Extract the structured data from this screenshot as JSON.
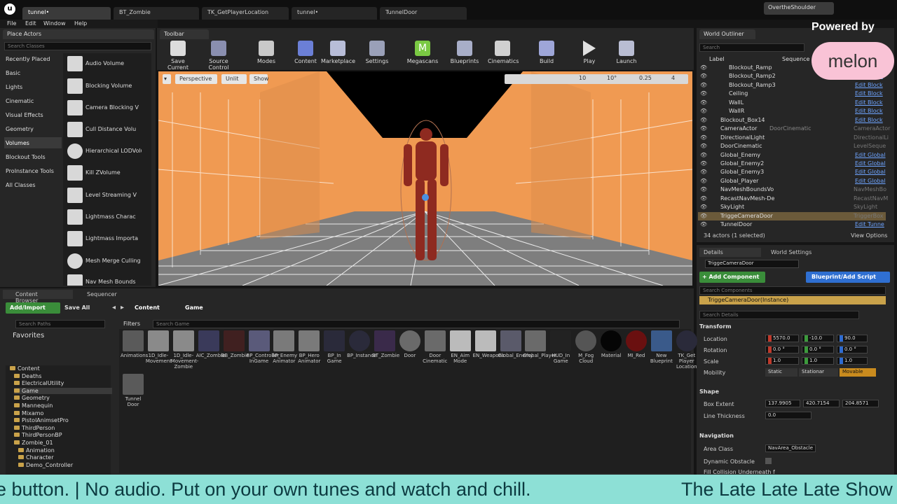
{
  "doc_tabs": [
    "tunnel•",
    "BT_Zombie",
    "TK_GetPlayerLocation",
    "tunnel•",
    "TunnelDoor"
  ],
  "user_tab": "OvertheShoulder",
  "menu": [
    "File",
    "Edit",
    "Window",
    "Help"
  ],
  "place_actors": {
    "tab": "Place Actors",
    "search_placeholder": "Search Classes",
    "categories": [
      "Recently Placed",
      "Basic",
      "Lights",
      "Cinematic",
      "Visual Effects",
      "Geometry",
      "Volumes",
      "Blockout Tools",
      "ProInstance Tools",
      "All Classes"
    ],
    "volumes": [
      "Audio Volume",
      "Blocking Volume",
      "Camera Blocking V",
      "Cull Distance Volu",
      "Hierarchical LODVolu",
      "Kill ZVolume",
      "Level Streaming V",
      "Lightmass Charac",
      "Lightmass Importa",
      "Mesh Merge Culling V",
      "Nav Mesh Bounds"
    ]
  },
  "toolbar": {
    "tab": "Toolbar",
    "items": [
      "Save Current",
      "Source Control",
      "Modes",
      "Content",
      "Marketplace",
      "Settings",
      "Megascans",
      "Blueprints",
      "Cinematics",
      "Build",
      "Play",
      "Launch"
    ]
  },
  "viewport": {
    "perspective": "Perspective",
    "unlit": "Unlit",
    "show": "Show",
    "snap_grid": "10",
    "snap_rot": "10°",
    "snap_scale": "0.25",
    "cam_speed": "4"
  },
  "outliner": {
    "tab": "World Outliner",
    "search_placeholder": "Search",
    "col_label": "Label",
    "col_sequence": "Sequence",
    "rows": [
      {
        "label": "Blockout_Ramp",
        "type": "Edit Block",
        "link": true
      },
      {
        "label": "Blockout_Ramp2",
        "type": "Edit Block",
        "link": true
      },
      {
        "label": "Blockout_Ramp3",
        "type": "Edit Block",
        "link": true
      },
      {
        "label": "Ceiling",
        "type": "Edit Block",
        "link": true
      },
      {
        "label": "WallL",
        "type": "Edit Block",
        "link": true
      },
      {
        "label": "WallR",
        "type": "Edit Block",
        "link": true
      },
      {
        "label": "Blockout_Box14",
        "type": "Edit Block",
        "link": true
      },
      {
        "label": "CameraActor",
        "seq": "DoorCinematic",
        "type": "CameraActor",
        "link": false
      },
      {
        "label": "DirectionalLight",
        "type": "DirectionalLi",
        "link": false
      },
      {
        "label": "DoorCinematic",
        "type": "LevelSeque",
        "link": false
      },
      {
        "label": "Global_Enemy",
        "type": "Edit Global",
        "link": true
      },
      {
        "label": "Global_Enemy2",
        "type": "Edit Global",
        "link": true
      },
      {
        "label": "Global_Enemy3",
        "type": "Edit Global",
        "link": true
      },
      {
        "label": "Global_Player",
        "type": "Edit Global",
        "link": true
      },
      {
        "label": "NavMeshBoundsVo",
        "type": "NavMeshBo",
        "link": false
      },
      {
        "label": "RecastNavMesh-De",
        "type": "RecastNavM",
        "link": false
      },
      {
        "label": "SkyLight",
        "type": "SkyLight",
        "link": false
      },
      {
        "label": "TriggeCameraDoor",
        "type": "TriggerBox",
        "link": false
      },
      {
        "label": "TunnelDoor",
        "type": "Edit Tunne",
        "link": true
      }
    ],
    "status": "34 actors (1 selected)",
    "view_options": "View Options"
  },
  "details": {
    "tab_details": "Details",
    "tab_world": "World Settings",
    "actor_name": "TriggeCameraDoor",
    "add_component": "+ Add Component",
    "blueprint": "Blueprint/Add Script",
    "search_components": "Search Components",
    "instance": "TriggeCameraDoor(Instance)",
    "search_details": "Search Details",
    "transform": "Transform",
    "location_label": "Location",
    "location": [
      "5570.0",
      "-10.0",
      "90.0"
    ],
    "rotation_label": "Rotation",
    "rotation": [
      "0.0 °",
      "0.0 °",
      "0.0 °"
    ],
    "scale_label": "Scale",
    "scale": [
      "1.0",
      "1.0",
      "1.0"
    ],
    "mobility_label": "Mobility",
    "mobility": [
      "Static",
      "Stationar",
      "Movable"
    ],
    "shape": "Shape",
    "box_extent_label": "Box Extent",
    "box_extent": [
      "137.9905",
      "420.7154",
      "204.8571"
    ],
    "line_thickness_label": "Line Thickness",
    "line_thickness": "0.0",
    "navigation": "Navigation",
    "area_class_label": "Area Class",
    "area_class": "NavArea_Obstacle",
    "dynamic_obstacle": "Dynamic Obstacle",
    "fill_collision": "Fill Collision Underneath f"
  },
  "content_browser": {
    "tab": "Content Browser",
    "tab2": "Sequencer",
    "add_import": "Add/Import",
    "save_all": "Save All",
    "path": [
      "Content",
      "Game"
    ],
    "search_paths": "Search Paths",
    "filters": "Filters",
    "search_game": "Search Game",
    "favorites": "Favorites",
    "tree": [
      "Content",
      "Deaths",
      "ElectricalUtility",
      "Game",
      "Geometry",
      "Mannequin",
      "Mixamo",
      "PistolAnimsetPro",
      "ThirdPerson",
      "ThirdPersonBP",
      "Zombie_01",
      "Animation",
      "Character",
      "Demo_Controller"
    ],
    "assets": [
      "Animations",
      "1D_Idle-Movement",
      "1D_Idle-Movement-Zombie",
      "AIC_Zombie",
      "BB_Zombie",
      "BP_Controller InGame",
      "BP_Enemy Animator",
      "BP_Hero Animator",
      "BP_In Game",
      "BP_Instance",
      "BT_Zombie",
      "Door",
      "Door Cinematic",
      "EN_Aim Mode",
      "EN_Weapons",
      "Global_Enemy",
      "Global_Player",
      "HUD_In Game",
      "M_Fog Cloud",
      "Material",
      "MI_Red",
      "New Blueprint",
      "TK_Get Player Location",
      "Tunnel Door"
    ]
  },
  "overlay": {
    "powered_by": "Powered by",
    "brand": "melon",
    "ticker_left": "e button. | No audio. Put on your own tunes and watch and chill.",
    "ticker_right": "The Late Late Late Show w"
  },
  "colors": {
    "accent": "#f09a52",
    "ticker": "#8de0d6",
    "selection": "#c9a24a"
  }
}
